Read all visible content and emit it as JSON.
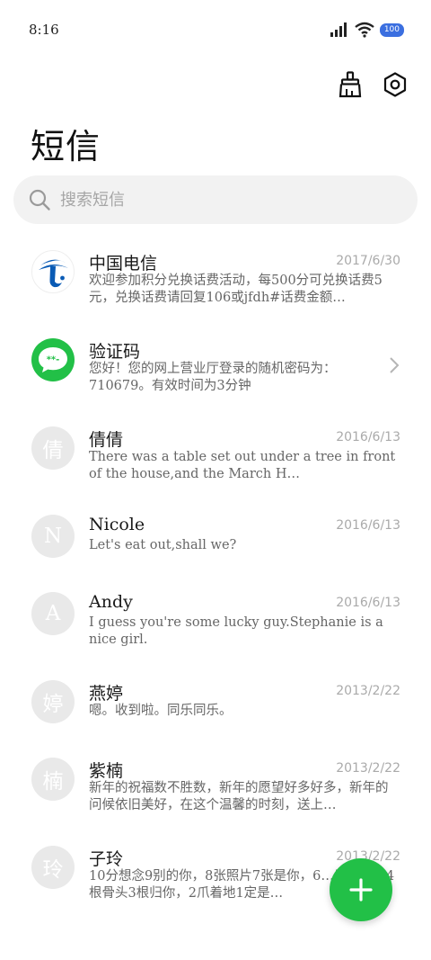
{
  "status_bar": {
    "time": "8:16",
    "battery": "100"
  },
  "toolbar": {
    "clean_icon": "broom-icon",
    "settings_icon": "gear-icon"
  },
  "title": "短信",
  "search": {
    "placeholder": "搜索短信"
  },
  "messages": [
    {
      "sender": "中国电信",
      "date": "2017/6/30",
      "preview": "欢迎参加积分兑换话费活动，每500分可兑换话费5元，兑换话费请回复106或jfdh#话费金额…",
      "avatar": "china-telecom-logo"
    },
    {
      "sender": "验证码",
      "date": "",
      "preview": "您好！您的网上营业厅登录的随机密码为：710679。有效时间为3分钟",
      "avatar": "verification-chat-icon"
    },
    {
      "sender": "倩倩",
      "date": "2016/6/13",
      "preview": "There was a table set out under a tree in front of the house,and the March H…",
      "avatar_letter": "倩"
    },
    {
      "sender": "Nicole",
      "date": "2016/6/13",
      "preview": "Let's eat out,shall we?",
      "avatar_letter": "N"
    },
    {
      "sender": "Andy",
      "date": "2016/6/13",
      "preview": "I guess you're some lucky guy.Stephanie is a nice girl.",
      "avatar_letter": "A"
    },
    {
      "sender": "燕婷",
      "date": "2013/2/22",
      "preview": "嗯。收到啦。同乐同乐。",
      "avatar_letter": "婷"
    },
    {
      "sender": "紫楠",
      "date": "2013/2/22",
      "preview": "新年的祝福数不胜数，新年的愿望好多好多，新年的问候依旧美好，在这个温馨的时刻，送上…",
      "avatar_letter": "楠"
    },
    {
      "sender": "子玲",
      "date": "2013/2/22",
      "preview": "10分想念9别的你，8张照片7张是你，6…只像你，4根骨头3根归你，2爪着地1定是…",
      "avatar_letter": "玲"
    }
  ],
  "fab": {
    "icon": "plus-icon"
  },
  "colors": {
    "accent": "#22c047",
    "telecom_blue": "#0a5bb5",
    "battery": "#3b6fe0"
  }
}
